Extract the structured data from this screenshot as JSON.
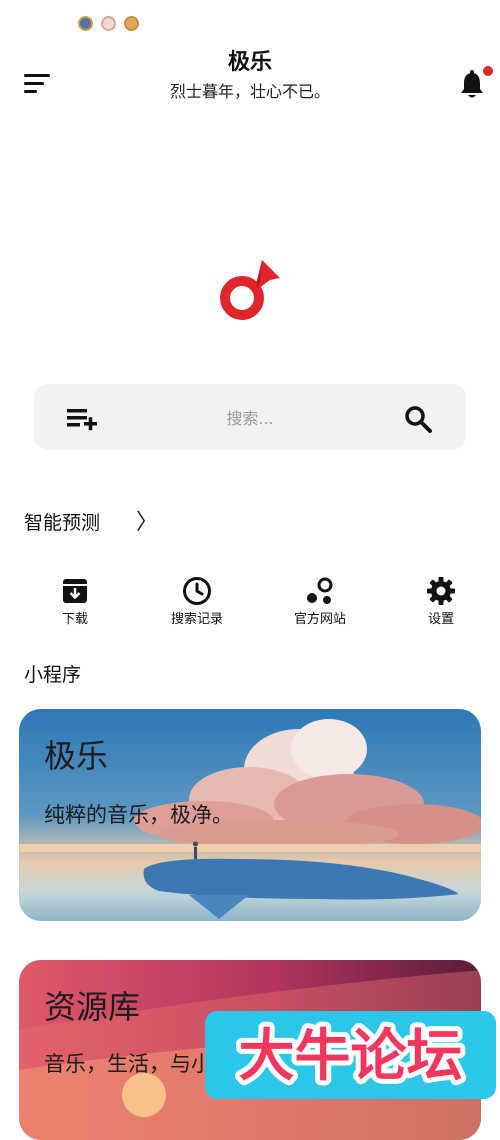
{
  "header": {
    "title": "极乐",
    "subtitle": "烈士暮年，壮心不已。"
  },
  "search": {
    "placeholder": "搜索..."
  },
  "smart_prediction": {
    "label": "智能预测",
    "arrow": "〉"
  },
  "quick_actions": [
    {
      "label": "下载",
      "icon": "download-icon"
    },
    {
      "label": "搜索记录",
      "icon": "clock-icon"
    },
    {
      "label": "官方网站",
      "icon": "bubbles-icon"
    },
    {
      "label": "设置",
      "icon": "gear-icon"
    }
  ],
  "mini_programs": {
    "title": "小程序",
    "cards": [
      {
        "title": "极乐",
        "subtitle": "纯粹的音乐，极净。"
      },
      {
        "title": "资源库",
        "subtitle": "音乐，生活，与小"
      }
    ]
  },
  "watermark": {
    "text": "大牛论坛"
  },
  "colors": {
    "accent": "#e0262d",
    "search_bg": "#f2f2f2"
  }
}
